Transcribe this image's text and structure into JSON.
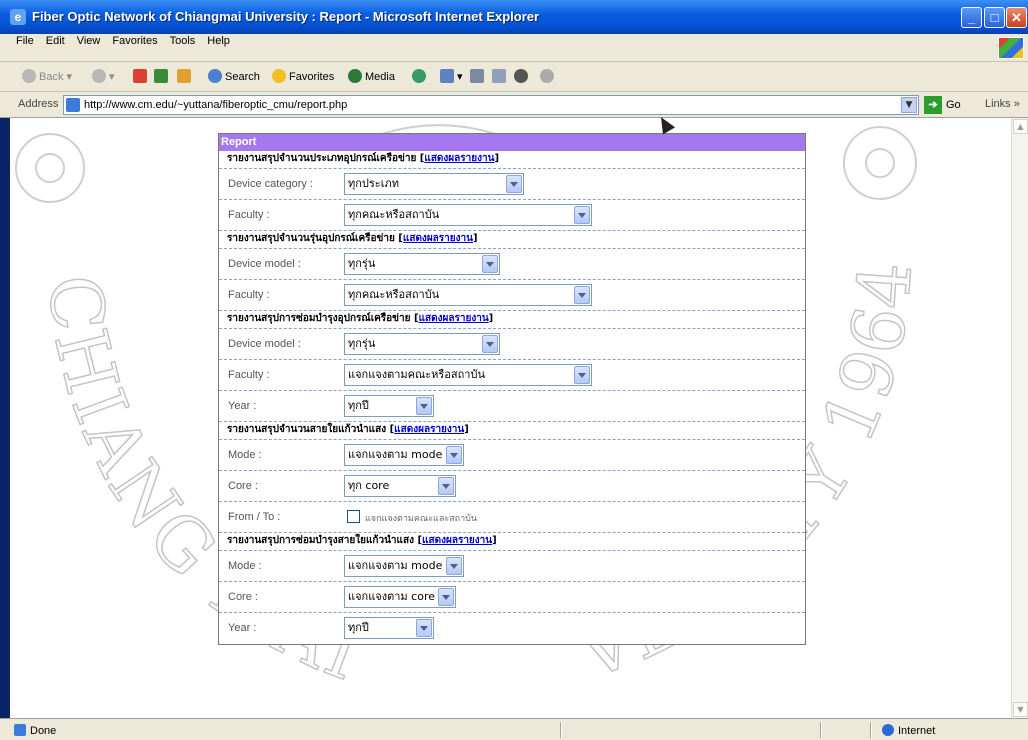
{
  "window": {
    "title": "Fiber Optic Network of Chiangmai University : Report - Microsoft Internet Explorer"
  },
  "menu": [
    "File",
    "Edit",
    "View",
    "Favorites",
    "Tools",
    "Help"
  ],
  "toolbar": {
    "back": "Back",
    "search": "Search",
    "favorites": "Favorites",
    "media": "Media"
  },
  "address": {
    "label": "Address",
    "url": "http://www.cm.edu/~yuttana/fiberoptic_cmu/report.php",
    "go": "Go",
    "links": "Links"
  },
  "watermark": {
    "text": "CHIANG MAI UNIVERSITY 1964"
  },
  "report": {
    "header": "Report",
    "show_link": "แสดงผลรายงาน",
    "sections": [
      {
        "title": "รายงานสรุปจำนวนประเภทอุปกรณ์เครือข่าย",
        "rows": [
          {
            "label": "Device category :",
            "value": "ทุกประเภท"
          },
          {
            "label": "Faculty :",
            "value": "ทุกคณะหรือสถาบัน"
          }
        ]
      },
      {
        "title": "รายงานสรุปจำนวนรุ่นอุปกรณ์เครือข่าย",
        "rows": [
          {
            "label": "Device model :",
            "value": "ทุกรุ่น"
          },
          {
            "label": "Faculty :",
            "value": "ทุกคณะหรือสถาบัน"
          }
        ]
      },
      {
        "title": "รายงานสรุปการซ่อมบำรุงอุปกรณ์เครือข่าย",
        "rows": [
          {
            "label": "Device model :",
            "value": "ทุกรุ่น"
          },
          {
            "label": "Faculty :",
            "value": "แจกแจงตามคณะหรือสถาบัน"
          },
          {
            "label": "Year :",
            "value": "ทุกปี"
          }
        ]
      },
      {
        "title": "รายงานสรุปจำนวนสายใยแก้วนำแสง",
        "rows": [
          {
            "label": "Mode :",
            "value": "แจกแจงตาม mode"
          },
          {
            "label": "Core :",
            "value": "ทุก core"
          },
          {
            "label": "From / To :",
            "checkbox": "แจกแจงตามคณะและสถาบัน"
          }
        ]
      },
      {
        "title": "รายงานสรุปการซ่อมบำรุงสายใยแก้วนำแสง",
        "rows": [
          {
            "label": "Mode :",
            "value": "แจกแจงตาม mode"
          },
          {
            "label": "Core :",
            "value": "แจกแจงตาม core"
          },
          {
            "label": "Year :",
            "value": "ทุกปี"
          }
        ]
      }
    ]
  },
  "status": {
    "left": "Done",
    "zone": "Internet"
  }
}
